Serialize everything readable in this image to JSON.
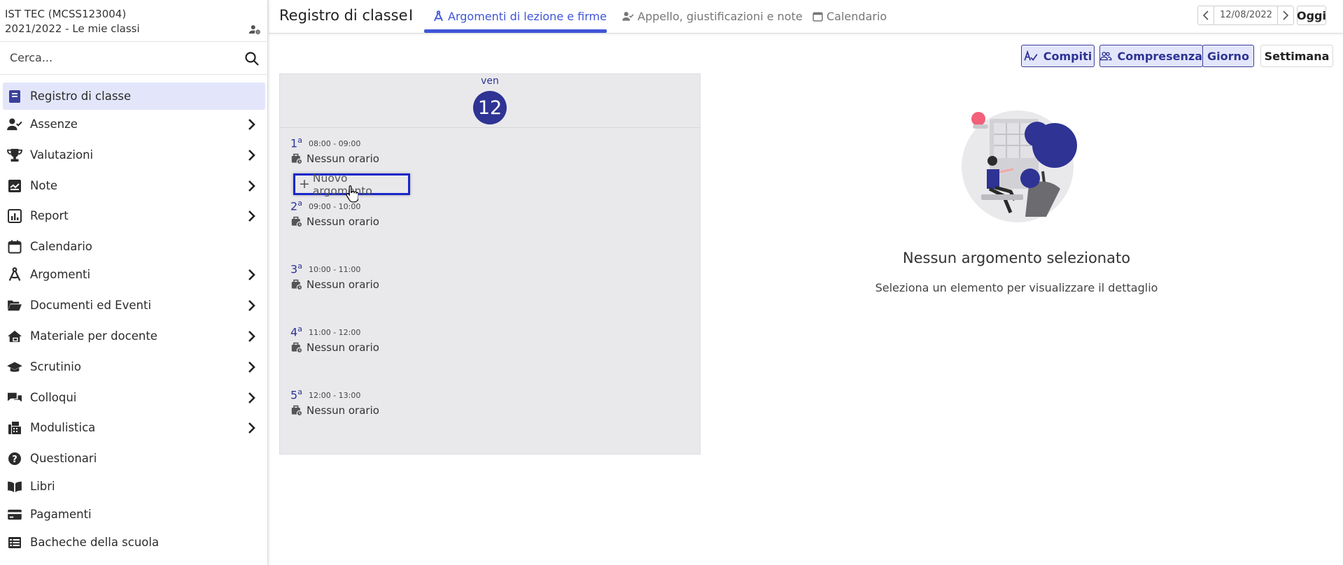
{
  "sidebar": {
    "school_name": "IST TEC (MCSS123004)",
    "school_year": "2021/2022 - Le mie classi",
    "search_placeholder": "Cerca...",
    "items": [
      {
        "label": "Registro di classe",
        "icon": "book-icon",
        "has_submenu": false,
        "active": true
      },
      {
        "label": "Assenze",
        "icon": "user-check-icon",
        "has_submenu": true
      },
      {
        "label": "Valutazioni",
        "icon": "trophy-icon",
        "has_submenu": true
      },
      {
        "label": "Note",
        "icon": "note-icon",
        "has_submenu": true
      },
      {
        "label": "Report",
        "icon": "report-icon",
        "has_submenu": true
      },
      {
        "label": "Calendario",
        "icon": "calendar-icon",
        "has_submenu": false
      },
      {
        "label": "Argomenti",
        "icon": "compass-icon",
        "has_submenu": true
      },
      {
        "label": "Documenti ed Eventi",
        "icon": "folder-open-icon",
        "has_submenu": true
      },
      {
        "label": "Materiale per docente",
        "icon": "home-book-icon",
        "has_submenu": true
      },
      {
        "label": "Scrutinio",
        "icon": "graduation-cap-icon",
        "has_submenu": true
      },
      {
        "label": "Colloqui",
        "icon": "chat-bubbles-icon",
        "has_submenu": true
      },
      {
        "label": "Modulistica",
        "icon": "fax-icon",
        "has_submenu": true
      },
      {
        "label": "Questionari",
        "icon": "help-circle-icon",
        "has_submenu": false
      },
      {
        "label": "Libri",
        "icon": "open-book-icon",
        "has_submenu": false
      },
      {
        "label": "Pagamenti",
        "icon": "credit-card-icon",
        "has_submenu": false
      },
      {
        "label": "Bacheche della scuola",
        "icon": "list-table-icon",
        "has_submenu": false
      }
    ]
  },
  "header": {
    "title": "Registro di classe",
    "separator": "I",
    "tabs": [
      {
        "label": "Argomenti di lezione e firme",
        "icon": "compass-icon",
        "active": true
      },
      {
        "label": "Appello, giustificazioni e note",
        "icon": "user-check-icon",
        "active": false
      },
      {
        "label": "Calendario",
        "icon": "calendar-icon",
        "active": false
      }
    ],
    "date": "12/08/2022",
    "today_label": "Oggi"
  },
  "view_buttons": {
    "compiti": "Compiti",
    "compresenza": "Compresenza",
    "giorno": "Giorno",
    "settimana": "Settimana"
  },
  "day": {
    "weekday": "ven",
    "number": "12",
    "hours": [
      {
        "num": "1",
        "sup": "a",
        "time": "08:00 - 09:00",
        "status": "Nessun orario"
      },
      {
        "num": "2",
        "sup": "a",
        "time": "09:00 - 10:00",
        "status": "Nessun orario"
      },
      {
        "num": "3",
        "sup": "a",
        "time": "10:00 - 11:00",
        "status": "Nessun orario"
      },
      {
        "num": "4",
        "sup": "a",
        "time": "11:00 - 12:00",
        "status": "Nessun orario"
      },
      {
        "num": "5",
        "sup": "a",
        "time": "12:00 - 13:00",
        "status": "Nessun orario"
      }
    ],
    "new_topic_label": "Nuovo argomento"
  },
  "empty_state": {
    "title": "Nessun argomento selezionato",
    "subtitle": "Seleziona un elemento per visualizzare il dettaglio"
  },
  "colors": {
    "accent": "#3f55d8",
    "primary_dark": "#2e3394",
    "active_bg": "#e3e6fa",
    "highlight_border": "#1927c9"
  }
}
